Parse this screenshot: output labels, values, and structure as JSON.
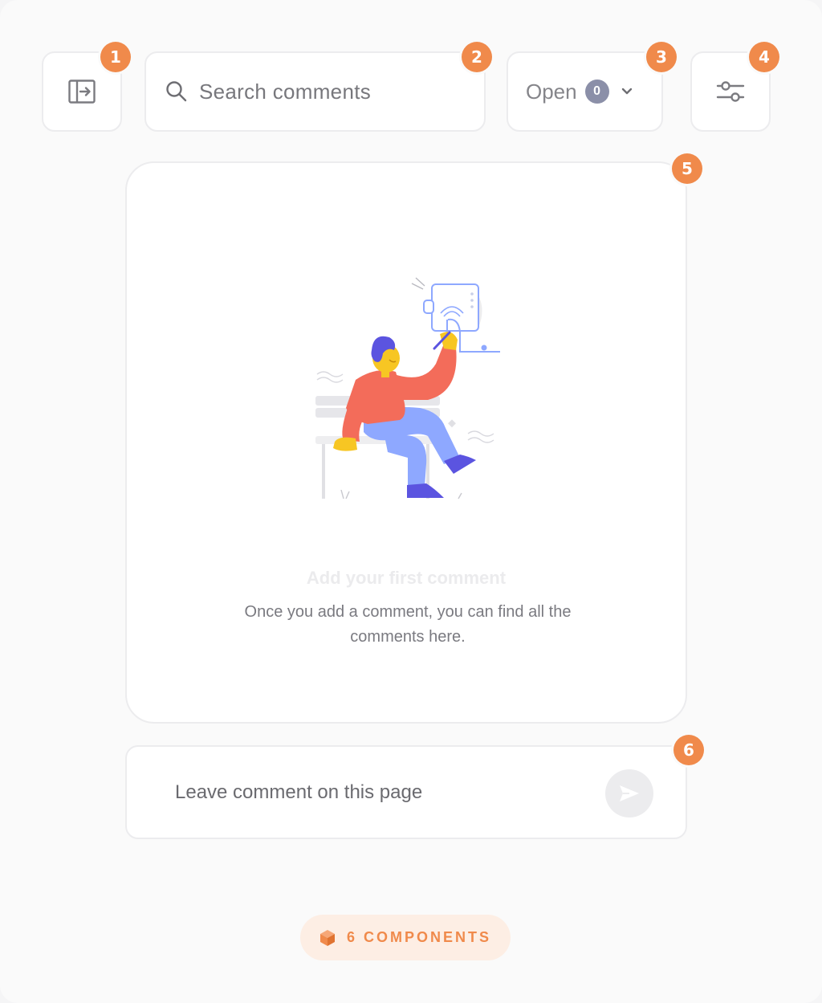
{
  "toolbar": {
    "panel_toggle_icon": "panel-collapse-icon",
    "search": {
      "placeholder": "Search comments",
      "icon": "search-icon"
    },
    "status_filter": {
      "label": "Open",
      "count": "0",
      "icon": "chevron-down-icon"
    },
    "settings_icon": "sliders-icon"
  },
  "callouts": [
    "1",
    "2",
    "3",
    "4",
    "5",
    "6"
  ],
  "empty_state": {
    "title": "Add your first comment",
    "description": "Once you add a comment, you can find all the comments here."
  },
  "composer": {
    "placeholder": "Leave comment on this page",
    "send_icon": "send-icon"
  },
  "footer": {
    "label": "6 COMPONENTS",
    "icon": "cube-icon"
  },
  "colors": {
    "accent": "#f08a4b",
    "badge_count": "#8b8fa8",
    "border": "#ececee",
    "illustration_shirt": "#f36c5a",
    "illustration_pants": "#8ea8ff",
    "illustration_skin": "#f7c623",
    "illustration_hair": "#5b54e0"
  }
}
